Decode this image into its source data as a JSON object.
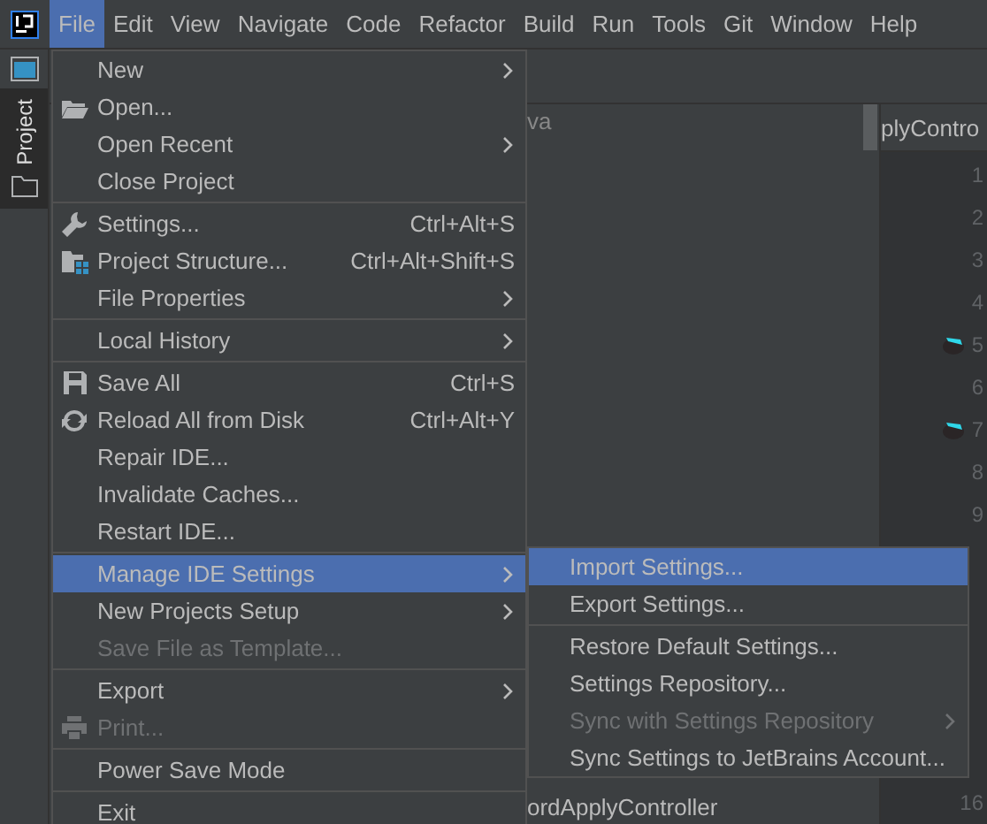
{
  "menu_bar": [
    {
      "label": "File",
      "selected": true
    },
    {
      "label": "Edit",
      "selected": false
    },
    {
      "label": "View",
      "selected": false
    },
    {
      "label": "Navigate",
      "selected": false
    },
    {
      "label": "Code",
      "selected": false
    },
    {
      "label": "Refactor",
      "selected": false
    },
    {
      "label": "Build",
      "selected": false
    },
    {
      "label": "Run",
      "selected": false
    },
    {
      "label": "Tools",
      "selected": false
    },
    {
      "label": "Git",
      "selected": false
    },
    {
      "label": "Window",
      "selected": false
    },
    {
      "label": "Help",
      "selected": false
    }
  ],
  "side_strip": {
    "tabs": [
      {
        "label": "Project",
        "selected": true
      }
    ]
  },
  "project_panel": {
    "rows": [
      "va",
      "ordApplyController"
    ]
  },
  "editor": {
    "tab": "plyContro",
    "line_numbers": [
      "1",
      "2",
      "3",
      "4",
      "5",
      "6",
      "7",
      "8",
      "9"
    ],
    "last_line_number": "16"
  },
  "file_menu": {
    "groups": [
      [
        {
          "label": "New",
          "submenu": true,
          "disabled": false,
          "selected": false
        },
        {
          "label": "Open...",
          "submenu": false,
          "disabled": false,
          "selected": false
        },
        {
          "label": "Open Recent",
          "submenu": true,
          "disabled": false,
          "selected": false
        },
        {
          "label": "Close Project",
          "submenu": false,
          "disabled": false,
          "selected": false
        }
      ],
      [
        {
          "label": "Settings...",
          "shortcut": "Ctrl+Alt+S",
          "submenu": false,
          "disabled": false,
          "selected": false
        },
        {
          "label": "Project Structure...",
          "shortcut": "Ctrl+Alt+Shift+S",
          "submenu": false,
          "disabled": false,
          "selected": false
        },
        {
          "label": "File Properties",
          "submenu": true,
          "disabled": false,
          "selected": false
        }
      ],
      [
        {
          "label": "Local History",
          "submenu": true,
          "disabled": false,
          "selected": false
        }
      ],
      [
        {
          "label": "Save All",
          "shortcut": "Ctrl+S",
          "submenu": false,
          "disabled": false,
          "selected": false
        },
        {
          "label": "Reload All from Disk",
          "shortcut": "Ctrl+Alt+Y",
          "submenu": false,
          "disabled": false,
          "selected": false
        },
        {
          "label": "Repair IDE...",
          "submenu": false,
          "disabled": false,
          "selected": false
        },
        {
          "label": "Invalidate Caches...",
          "submenu": false,
          "disabled": false,
          "selected": false
        },
        {
          "label": "Restart IDE...",
          "submenu": false,
          "disabled": false,
          "selected": false
        }
      ],
      [
        {
          "label": "Manage IDE Settings",
          "submenu": true,
          "disabled": false,
          "selected": true
        },
        {
          "label": "New Projects Setup",
          "submenu": true,
          "disabled": false,
          "selected": false
        },
        {
          "label": "Save File as Template...",
          "submenu": false,
          "disabled": true,
          "selected": false
        }
      ],
      [
        {
          "label": "Export",
          "submenu": true,
          "disabled": false,
          "selected": false
        },
        {
          "label": "Print...",
          "submenu": false,
          "disabled": true,
          "selected": false
        }
      ],
      [
        {
          "label": "Power Save Mode",
          "submenu": false,
          "disabled": false,
          "selected": false
        }
      ],
      [
        {
          "label": "Exit",
          "submenu": false,
          "disabled": false,
          "selected": false
        }
      ]
    ]
  },
  "submenu": {
    "groups": [
      [
        {
          "label": "Import Settings...",
          "submenu": false,
          "disabled": false,
          "selected": true
        },
        {
          "label": "Export Settings...",
          "submenu": false,
          "disabled": false,
          "selected": false
        }
      ],
      [
        {
          "label": "Restore Default Settings...",
          "submenu": false,
          "disabled": false,
          "selected": false
        },
        {
          "label": "Settings Repository...",
          "submenu": false,
          "disabled": false,
          "selected": false
        },
        {
          "label": "Sync with Settings Repository",
          "submenu": true,
          "disabled": true,
          "selected": false
        },
        {
          "label": "Sync Settings to JetBrains Account...",
          "submenu": false,
          "disabled": false,
          "selected": false
        }
      ]
    ]
  }
}
